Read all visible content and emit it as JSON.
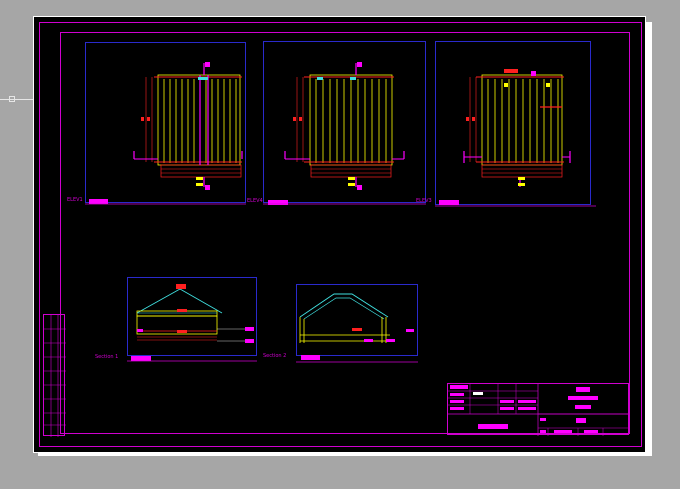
{
  "views": [
    {
      "label": "ELEV1"
    },
    {
      "label": "ELEV4"
    },
    {
      "label": "ELEV3"
    }
  ],
  "sections": [
    {
      "label": "Section 1"
    },
    {
      "label": "Section 2"
    }
  ],
  "colors": {
    "background": "#000000",
    "border": "#d000d0",
    "viewport": "#2a2acc",
    "highlight": "#ff00ff",
    "structure": "#ffff00",
    "accent": "#ff2020",
    "roof": "#40e0e0"
  }
}
